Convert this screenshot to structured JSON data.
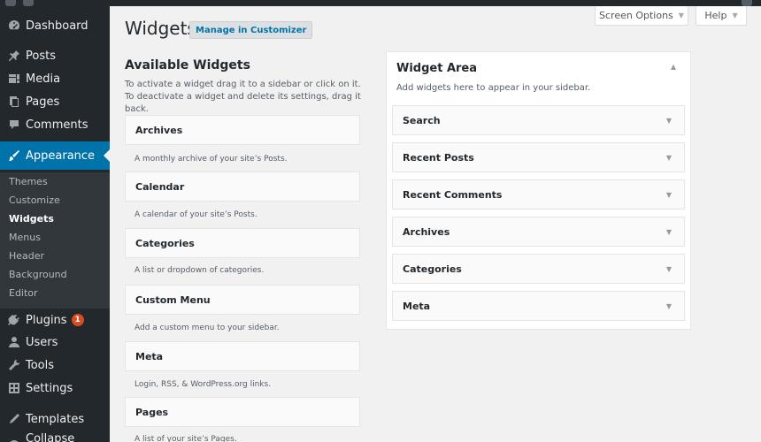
{
  "sidebar": {
    "items": [
      {
        "label": "Dashboard",
        "icon": "dashboard-icon"
      },
      {
        "label": "Posts",
        "icon": "pin-icon"
      },
      {
        "label": "Media",
        "icon": "media-icon"
      },
      {
        "label": "Pages",
        "icon": "page-icon"
      },
      {
        "label": "Comments",
        "icon": "comment-icon"
      },
      {
        "label": "Appearance",
        "icon": "brush-icon"
      },
      {
        "label": "Plugins",
        "icon": "plugin-icon",
        "badge": "1"
      },
      {
        "label": "Users",
        "icon": "user-icon"
      },
      {
        "label": "Tools",
        "icon": "wrench-icon"
      },
      {
        "label": "Settings",
        "icon": "settings-icon"
      },
      {
        "label": "Templates",
        "icon": "template-icon"
      },
      {
        "label": "Collapse menu",
        "icon": "collapse-icon"
      }
    ],
    "submenu": [
      "Themes",
      "Customize",
      "Widgets",
      "Menus",
      "Header",
      "Background",
      "Editor"
    ]
  },
  "header": {
    "screen_options": "Screen Options",
    "help": "Help",
    "title": "Widgets",
    "manage_button": "Manage in Customizer"
  },
  "available": {
    "title": "Available Widgets",
    "description": "To activate a widget drag it to a sidebar or click on it. To deactivate a widget and delete its settings, drag it back.",
    "widgets": [
      {
        "name": "Archives",
        "desc": "A monthly archive of your site’s Posts."
      },
      {
        "name": "Calendar",
        "desc": "A calendar of your site’s Posts."
      },
      {
        "name": "Categories",
        "desc": "A list or dropdown of categories."
      },
      {
        "name": "Custom Menu",
        "desc": "Add a custom menu to your sidebar."
      },
      {
        "name": "Meta",
        "desc": "Login, RSS, & WordPress.org links."
      },
      {
        "name": "Pages",
        "desc": "A list of your site’s Pages."
      }
    ]
  },
  "widget_area": {
    "title": "Widget Area",
    "description": "Add widgets here to appear in your sidebar.",
    "widgets": [
      "Search",
      "Recent Posts",
      "Recent Comments",
      "Archives",
      "Categories",
      "Meta"
    ]
  },
  "colors": {
    "sidebar_bg": "#23282d",
    "active": "#0073aa",
    "badge": "#d54e21",
    "content_bg": "#f1f1f1"
  }
}
